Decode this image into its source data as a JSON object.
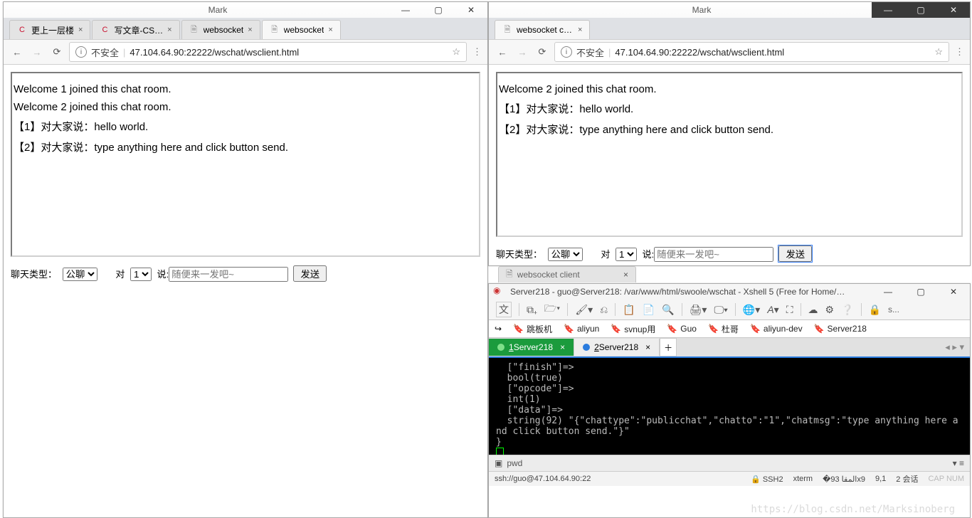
{
  "leftWindow": {
    "title": "Mark",
    "tabs": [
      {
        "favicon": "C",
        "faviconColor": "#c8102e",
        "title": "更上一层楼",
        "active": false
      },
      {
        "favicon": "C",
        "faviconColor": "#c8102e",
        "title": "写文章-CS…",
        "active": false
      },
      {
        "favicon": "🗎",
        "faviconColor": "#888",
        "title": "websocket",
        "active": false
      },
      {
        "favicon": "🗎",
        "faviconColor": "#888",
        "title": "websocket",
        "active": true
      }
    ],
    "insecureLabel": "不安全",
    "url": "47.104.64.90:22222/wschat/wsclient.html",
    "messages": [
      "Welcome 1 joined this chat room.",
      "Welcome 2 joined this chat room.",
      "【1】对大家说：hello world.",
      "【2】对大家说：type anything here and click button send."
    ],
    "labels": {
      "chatType": "聊天类型：",
      "to": "对",
      "say": "说:",
      "inputPlaceholder": "随便来一发吧~",
      "sendButton": "发送"
    },
    "chatTypeSelected": "公聊",
    "toSelected": "1"
  },
  "rightWindow": {
    "title": "Mark",
    "tabs": [
      {
        "favicon": "🗎",
        "faviconColor": "#888",
        "title": "websocket client",
        "active": true
      }
    ],
    "insecureLabel": "不安全",
    "url": "47.104.64.90:22222/wschat/wsclient.html",
    "messages": [
      "Welcome 2 joined this chat room.",
      "【1】对大家说：hello world.",
      "【2】对大家说：type anything here and click button send."
    ],
    "labels": {
      "chatType": "聊天类型：",
      "to": "对",
      "say": "说:",
      "inputPlaceholder": "随便来一发吧~",
      "sendButton": "发送"
    },
    "chatTypeSelected": "公聊",
    "toSelected": "1"
  },
  "ghostTab": {
    "title": "websocket client"
  },
  "xshell": {
    "title": "Server218 - guo@Server218: /var/www/html/swoole/wschat - Xshell 5 (Free for Home/…",
    "langBtn": "文",
    "searchLabel": "s...",
    "bookmarks": [
      "跳板机",
      "aliyun",
      "svnup用",
      "Guo",
      "杜哥",
      "aliyun-dev",
      "Server218"
    ],
    "tabs": [
      {
        "label": "1 Server218",
        "active": true
      },
      {
        "label": "2 Server218",
        "active": false
      }
    ],
    "terminalLines": [
      "  [\"finish\"]=>",
      "  bool(true)",
      "  [\"opcode\"]=>",
      "  int(1)",
      "  [\"data\"]=>",
      "  string(92) \"{\"chattype\":\"publicchat\",\"chatto\":\"1\",\"chatmsg\":\"type anything here and click button send.\"}\"",
      "}"
    ],
    "pwdLabel": "pwd",
    "status": {
      "left": "ssh://guo@47.104.64.90:22",
      "ssh": "SSH2",
      "term": "xterm",
      "size": "93x9",
      "pos": "9,1",
      "session": "2 会话",
      "caps": "CAP NUM"
    }
  },
  "watermark": "https://blog.csdn.net/Marksinoberg"
}
